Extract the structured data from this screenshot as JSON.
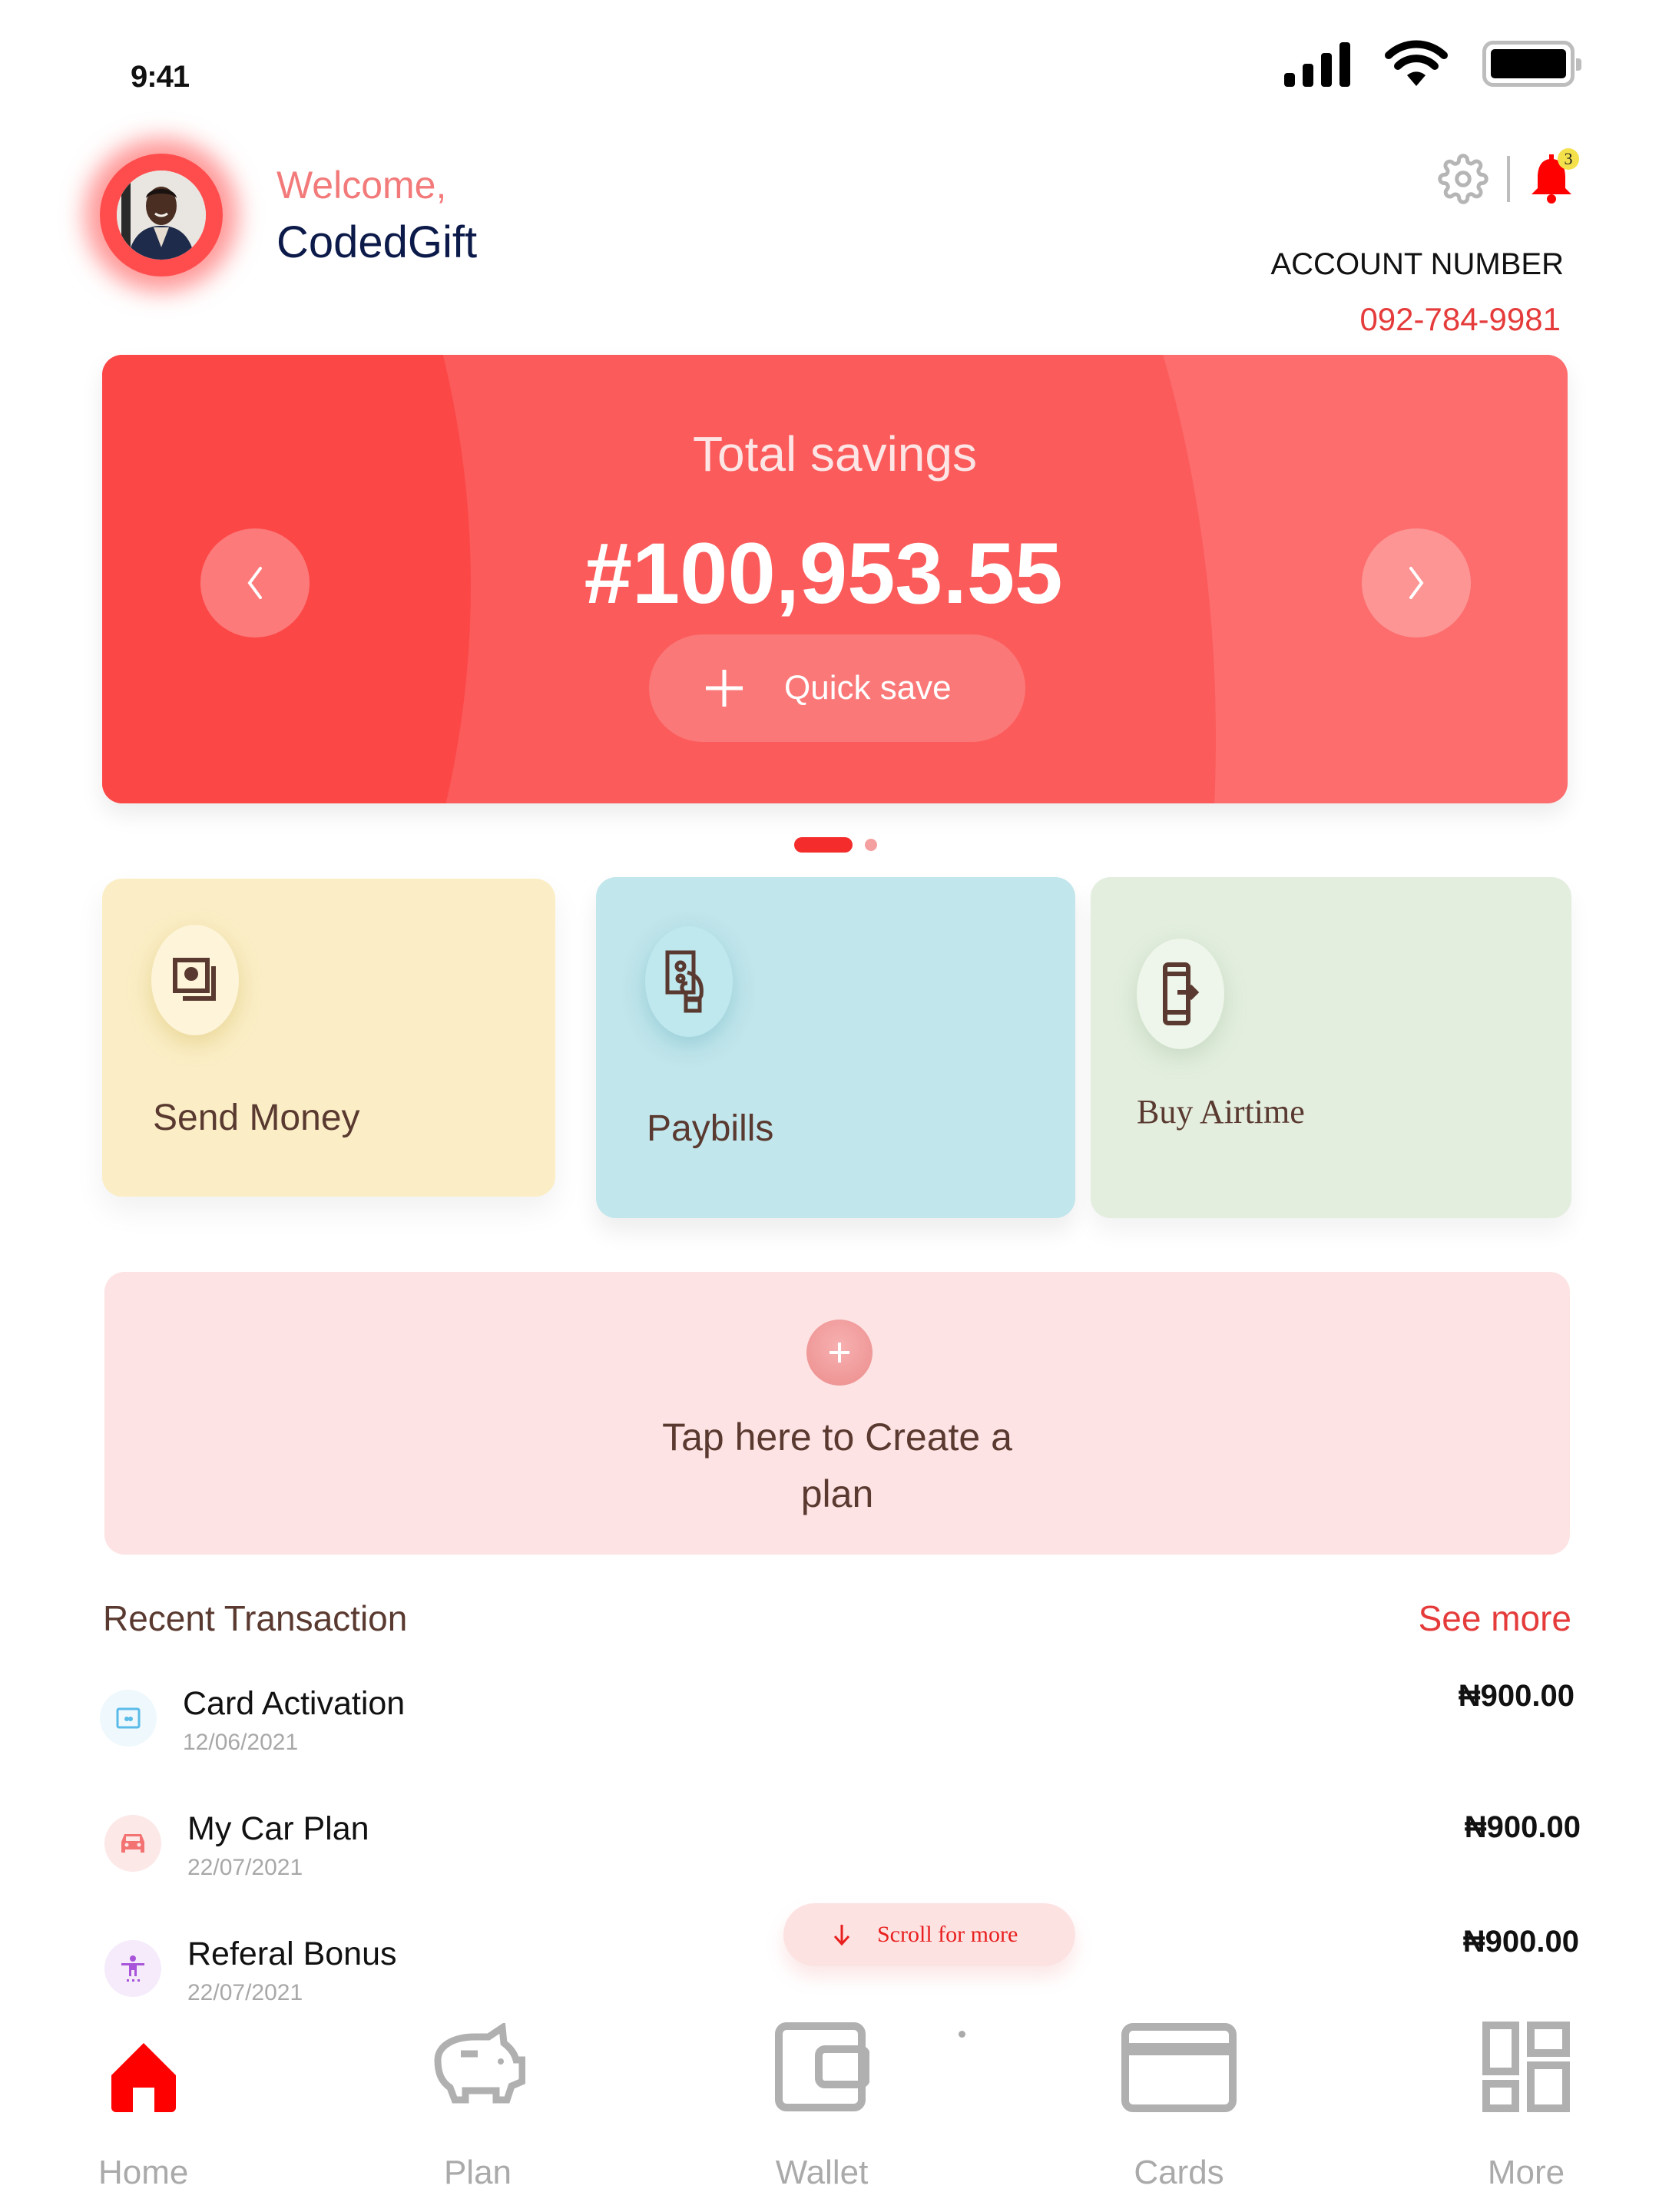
{
  "status_bar": {
    "time": "9:41",
    "icons": [
      "cellular-signal-icon",
      "wifi-icon",
      "battery-icon"
    ]
  },
  "header": {
    "welcome": "Welcome,",
    "username": "CodedGift",
    "avatar_alt": "profile photo",
    "notification_count": "3",
    "account_label": "ACCOUNT NUMBER",
    "account_number": "092-784-9981"
  },
  "savings_card": {
    "title": "Total savings",
    "amount": "#100,953.55",
    "quick_save_label": "Quick save",
    "carousel_pages": 2,
    "carousel_active": 1
  },
  "actions": [
    {
      "label": "Send Money",
      "icon": "send-money-icon",
      "color": "#fbeec6"
    },
    {
      "label": "Paybills",
      "icon": "paybills-icon",
      "color": "#c1e6ec"
    },
    {
      "label": "Buy Airtime",
      "icon": "buy-airtime-icon",
      "color": "#e3eedf"
    }
  ],
  "create_plan": {
    "line1": "Tap here to Create a",
    "line2": "plan"
  },
  "recent": {
    "title": "Recent Transaction",
    "see_more": "See more",
    "transactions": [
      {
        "name": "Card Activation",
        "date": "12/06/2021",
        "amount": "₦900.00",
        "icon": "card-icon"
      },
      {
        "name": "My Car Plan",
        "date": "22/07/2021",
        "amount": "₦900.00",
        "icon": "car-icon"
      },
      {
        "name": "Referal Bonus",
        "date": "22/07/2021",
        "amount": "₦900.00",
        "icon": "person-icon"
      }
    ]
  },
  "scroll_hint": "Scroll for more",
  "bottom_nav": [
    {
      "label": "Home",
      "active": true
    },
    {
      "label": "Plan",
      "active": false
    },
    {
      "label": "Wallet",
      "active": false
    },
    {
      "label": "Cards",
      "active": false
    },
    {
      "label": "More",
      "active": false
    }
  ],
  "colors": {
    "accent": "#ff0000",
    "brand_red": "#fd6d6d",
    "text_brown": "#5a3a30",
    "nav_inactive": "#aaaaaa"
  }
}
